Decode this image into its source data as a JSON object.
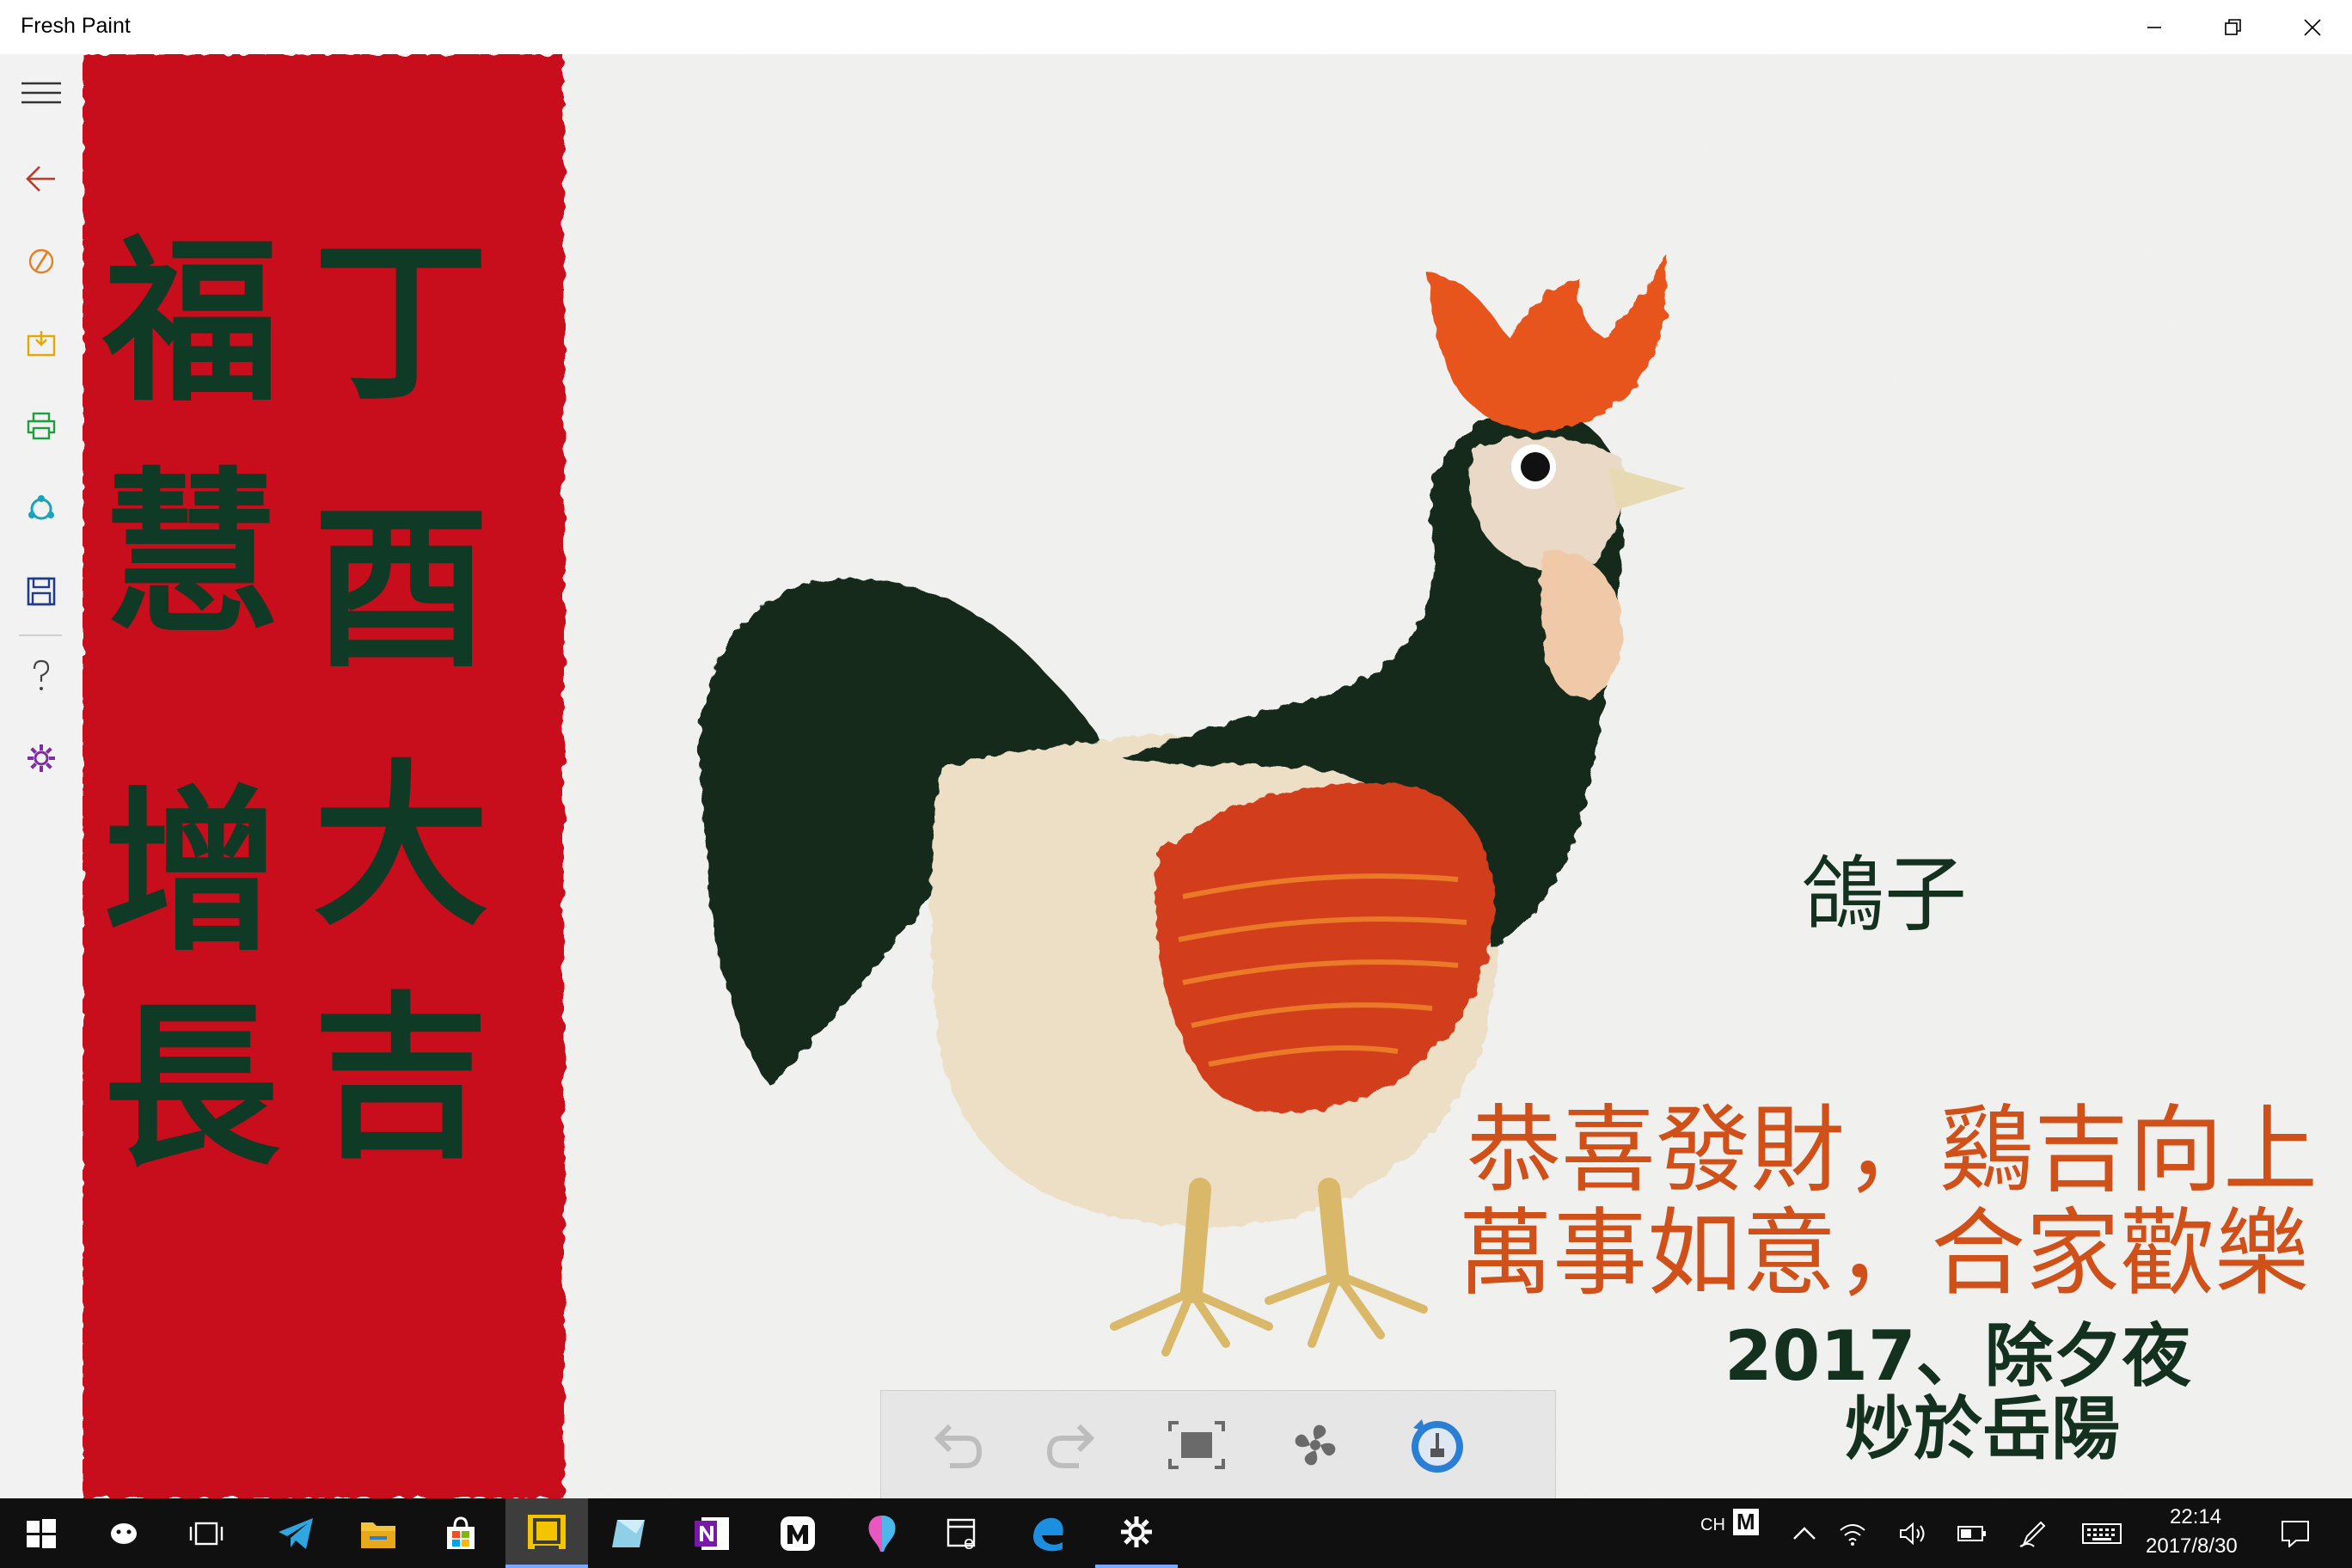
{
  "window": {
    "title": "Fresh Paint",
    "minimize_label": "",
    "restore_label": "",
    "close_label": ""
  },
  "leftbar": {
    "items": [
      {
        "name": "menu",
        "icon": "hamburger-icon"
      },
      {
        "name": "back",
        "icon": "back-arrow-icon",
        "color": "#c0392b"
      },
      {
        "name": "paint",
        "icon": "palette-brush-icon",
        "color": "#e67e22"
      },
      {
        "name": "import",
        "icon": "import-icon",
        "color": "#e6a700"
      },
      {
        "name": "print",
        "icon": "printer-icon",
        "color": "#1e9e3e"
      },
      {
        "name": "share",
        "icon": "share-icon",
        "color": "#1aa3b8"
      },
      {
        "name": "save",
        "icon": "save-icon",
        "color": "#1f3b8a"
      },
      {
        "name": "help",
        "icon": "help-icon",
        "color": "#444444"
      },
      {
        "name": "settings",
        "icon": "settings-gear-icon",
        "color": "#7b2fa0"
      }
    ]
  },
  "painting": {
    "banner_color": "#c8101a",
    "couplet_left": [
      "福",
      "慧",
      "增",
      "長"
    ],
    "couplet_right": [
      "丁",
      "酉",
      "大",
      "吉"
    ],
    "signature": "鴿子",
    "greeting_line1": "恭喜發財，鷄吉向上",
    "greeting_line2": "萬事如意，合家歡樂",
    "date_line1": "2017、除夕夜",
    "date_line2": "炒於岳陽",
    "greeting_color": "#d0501a",
    "date_color": "#14301f"
  },
  "tool_tray": {
    "buttons": [
      {
        "name": "undo",
        "icon": "undo-icon"
      },
      {
        "name": "redo",
        "icon": "redo-icon"
      },
      {
        "name": "fit",
        "icon": "fit-to-screen-icon"
      },
      {
        "name": "fan",
        "icon": "fan-dry-icon"
      },
      {
        "name": "brush-picker",
        "icon": "brush-picker-icon"
      }
    ]
  },
  "taskbar": {
    "apps": [
      {
        "name": "start",
        "icon": "windows-start-icon"
      },
      {
        "name": "cortana",
        "icon": "cortana-icon"
      },
      {
        "name": "task-view",
        "icon": "task-view-icon"
      },
      {
        "name": "telegram",
        "icon": "telegram-icon"
      },
      {
        "name": "file-explorer",
        "icon": "file-explorer-icon"
      },
      {
        "name": "store",
        "icon": "store-icon"
      },
      {
        "name": "fresh-paint",
        "icon": "fresh-paint-icon",
        "active": true
      },
      {
        "name": "sketch-app",
        "icon": "sketch-app-icon"
      },
      {
        "name": "onenote",
        "icon": "onenote-icon"
      },
      {
        "name": "media-app",
        "icon": "media-app-icon"
      },
      {
        "name": "paint-3d",
        "icon": "paint-3d-icon"
      },
      {
        "name": "web-app",
        "icon": "web-app-icon"
      },
      {
        "name": "edge",
        "icon": "edge-icon"
      },
      {
        "name": "settings",
        "icon": "settings-icon"
      }
    ],
    "ime_lang": "CH",
    "ime_mode": "M",
    "time": "22:14",
    "date": "2017/8/30"
  }
}
